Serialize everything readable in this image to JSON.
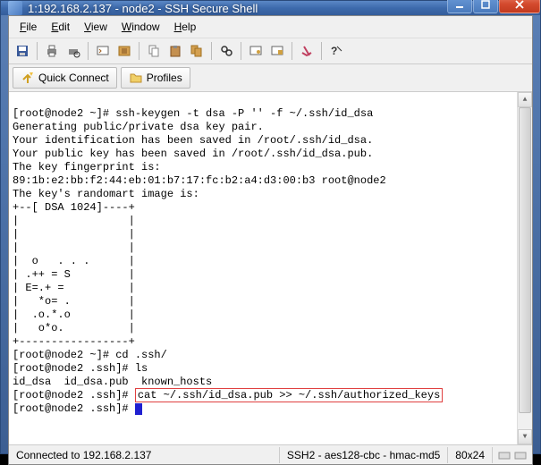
{
  "window": {
    "title": "1:192.168.2.137 - node2 - SSH Secure Shell"
  },
  "menu": {
    "file": "File",
    "edit": "Edit",
    "view": "View",
    "window": "Window",
    "help": "Help"
  },
  "quickbar": {
    "connect": "Quick Connect",
    "profiles": "Profiles"
  },
  "terminal": {
    "lines": [
      "[root@node2 ~]# ssh-keygen -t dsa -P '' -f ~/.ssh/id_dsa",
      "Generating public/private dsa key pair.",
      "Your identification has been saved in /root/.ssh/id_dsa.",
      "Your public key has been saved in /root/.ssh/id_dsa.pub.",
      "The key fingerprint is:",
      "89:1b:e2:bb:f2:44:eb:01:b7:17:fc:b2:a4:d3:00:b3 root@node2",
      "The key's randomart image is:",
      "+--[ DSA 1024]----+",
      "|                 |",
      "|                 |",
      "|                 |",
      "|  o   . . .      |",
      "| .++ = S         |",
      "| E=.+ =          |",
      "|   *o= .         |",
      "|  .o.*.o         |",
      "|   o*o.          |",
      "+-----------------+",
      "[root@node2 ~]# cd .ssh/",
      "[root@node2 .ssh]# ls",
      "id_dsa  id_dsa.pub  known_hosts"
    ],
    "highlight_prompt": "[root@node2 .ssh]# ",
    "highlight_cmd": "cat ~/.ssh/id_dsa.pub >> ~/.ssh/authorized_keys",
    "last_prompt": "[root@node2 .ssh]# "
  },
  "status": {
    "connection": "Connected to 192.168.2.137",
    "cipher": "SSH2 - aes128-cbc - hmac-md5",
    "size": "80x24"
  },
  "icons": {
    "save": "save-icon",
    "print": "print-icon",
    "printpreview": "printpreview-icon",
    "newterm": "newterm-icon",
    "newfile": "newfile-icon",
    "copy": "copy-icon",
    "paste": "paste-icon",
    "duplicate": "duplicate-icon",
    "find": "find-icon",
    "settings1": "settings1-icon",
    "settings2": "settings2-icon",
    "disconnect": "disconnect-icon",
    "help": "help-icon",
    "connect": "connect-icon",
    "folder": "folder-icon"
  }
}
